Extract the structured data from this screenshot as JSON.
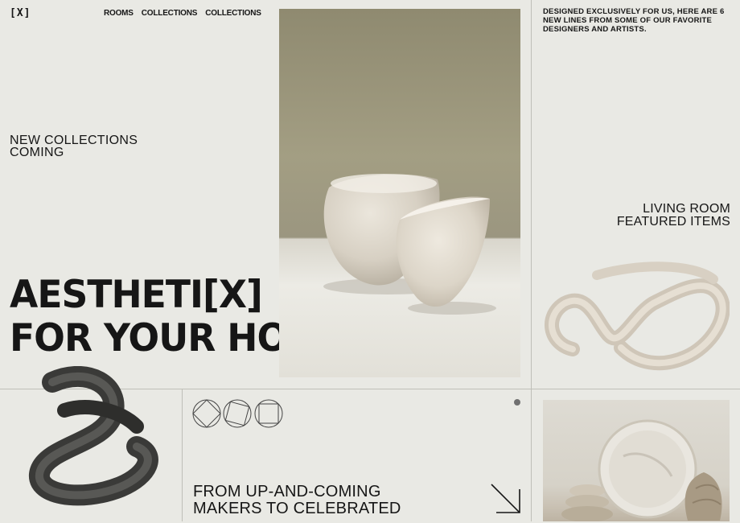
{
  "header": {
    "logo": "[X]",
    "nav": [
      "ROOMS",
      "COLLECTIONS",
      "COLLECTIONS"
    ]
  },
  "intro": {
    "coming_lines": [
      "NEW COLLECTIONS",
      "COMING"
    ]
  },
  "hero": {
    "lines": [
      "AESTHETI[X]",
      "FOR YOUR HOME"
    ]
  },
  "side": {
    "tagline": "DESIGNED EXCLUSIVELY FOR US, HERE ARE 6 NEW LINES FROM SOME OF OUR FAVORITE DESIGNERS AND ARTISTS.",
    "living_lines": [
      "LIVING ROOM",
      "FEATURED ITEMS"
    ]
  },
  "bottom": {
    "makers_lines": [
      "FROM UP-AND-COMING",
      "MAKERS TO CELEBRATED"
    ]
  },
  "icons": {
    "shapes": [
      "circle-diamond-icon",
      "circle-rotated-square-icon",
      "circle-square-icon"
    ],
    "arrow": "arrow-down-right-icon"
  },
  "colors": {
    "background": "#e9e9e4",
    "text": "#161616",
    "divider": "#bfbfb8"
  }
}
